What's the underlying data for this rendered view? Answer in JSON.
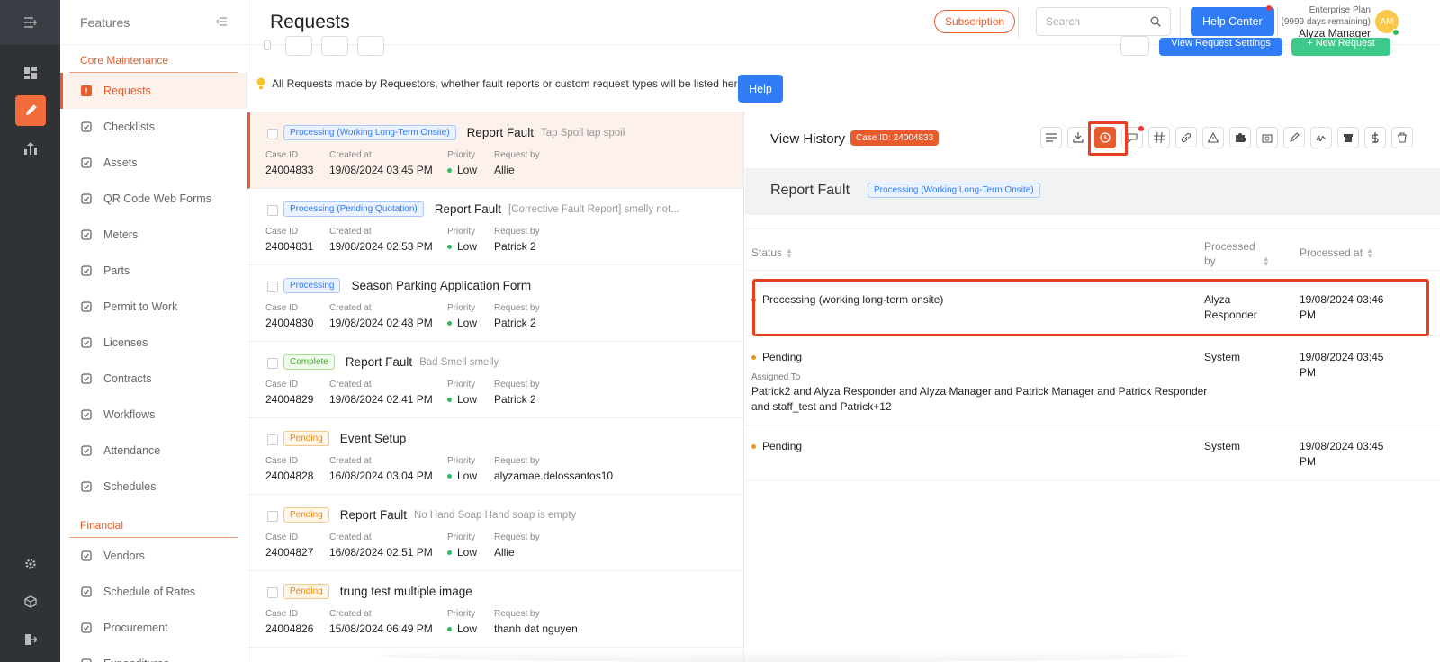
{
  "header": {
    "title": "Requests",
    "subscription_label": "Subscription",
    "search_placeholder": "Search",
    "help_center_label": "Help Center",
    "plan_name": "Enterprise Plan",
    "plan_remaining": "(9999 days remaining)",
    "user_name": "Alyza Manager",
    "avatar_initials": "AM"
  },
  "features": {
    "title": "Features",
    "sections": [
      {
        "label": "Core Maintenance",
        "items": [
          {
            "label": "Requests",
            "icon": "request-icon",
            "active": true
          },
          {
            "label": "Checklists",
            "icon": "checklist-icon"
          },
          {
            "label": "Assets",
            "icon": "asset-icon"
          },
          {
            "label": "QR Code Web Forms",
            "icon": "qr-code-icon"
          },
          {
            "label": "Meters",
            "icon": "meter-icon"
          },
          {
            "label": "Parts",
            "icon": "puzzle-icon"
          },
          {
            "label": "Permit to Work",
            "icon": "helmet-icon"
          },
          {
            "label": "Licenses",
            "icon": "shield-icon"
          },
          {
            "label": "Contracts",
            "icon": "contract-icon"
          },
          {
            "label": "Workflows",
            "icon": "workflow-icon"
          },
          {
            "label": "Attendance",
            "icon": "attendance-icon"
          },
          {
            "label": "Schedules",
            "icon": "calendar-icon"
          }
        ]
      },
      {
        "label": "Financial",
        "items": [
          {
            "label": "Vendors",
            "icon": "vendor-icon"
          },
          {
            "label": "Schedule of Rates",
            "icon": "dollar-icon"
          },
          {
            "label": "Procurement",
            "icon": "procurement-icon"
          },
          {
            "label": "Expenditures",
            "icon": "expenditure-icon"
          }
        ]
      }
    ]
  },
  "info": {
    "text": "All Requests made by Requestors, whether fault reports or custom request types will be listed here.",
    "help_label": "Help",
    "view_settings_label": "View Request Settings",
    "new_request_label": "+ New Request"
  },
  "labels": {
    "case_id": "Case ID",
    "created_at": "Created at",
    "priority": "Priority",
    "request_by": "Request by"
  },
  "requests": [
    {
      "badge": "Processing (Working Long-Term Onsite)",
      "badge_color": "blue",
      "title": "Report Fault",
      "sub": "Tap Spoil   tap spoil",
      "case_id": "24004833",
      "created": "19/08/2024 03:45 PM",
      "priority": "Low",
      "by": "Allie",
      "active": true
    },
    {
      "badge": "Processing (Pending Quotation)",
      "badge_color": "blue",
      "title": "Report Fault",
      "sub": "[Corrective Fault Report] smelly not...",
      "case_id": "24004831",
      "created": "19/08/2024 02:53 PM",
      "priority": "Low",
      "by": "Patrick 2"
    },
    {
      "badge": "Processing",
      "badge_color": "blue",
      "title": "Season Parking Application Form",
      "sub": "",
      "case_id": "24004830",
      "created": "19/08/2024 02:48 PM",
      "priority": "Low",
      "by": "Patrick 2"
    },
    {
      "badge": "Complete",
      "badge_color": "green",
      "title": "Report Fault",
      "sub": "Bad Smell   smelly",
      "case_id": "24004829",
      "created": "19/08/2024 02:41 PM",
      "priority": "Low",
      "by": "Patrick 2"
    },
    {
      "badge": "Pending",
      "badge_color": "orange",
      "title": "Event Setup",
      "sub": "",
      "case_id": "24004828",
      "created": "16/08/2024 03:04 PM",
      "priority": "Low",
      "by": "alyzamae.delossantos10"
    },
    {
      "badge": "Pending",
      "badge_color": "orange",
      "title": "Report Fault",
      "sub": "No Hand Soap   Hand soap is empty",
      "case_id": "24004827",
      "created": "16/08/2024 02:51 PM",
      "priority": "Low",
      "by": "Allie"
    },
    {
      "badge": "Pending",
      "badge_color": "orange",
      "title": "trung test multiple image",
      "sub": "",
      "case_id": "24004826",
      "created": "15/08/2024 06:49 PM",
      "priority": "Low",
      "by": "thanh dat nguyen"
    }
  ],
  "detail": {
    "view_history": "View History",
    "case_badge": "Case ID: 24004833",
    "title": "Report Fault",
    "status_badge": "Processing (Working Long-Term Onsite)",
    "columns": {
      "status": "Status",
      "processed_by_1": "Processed",
      "processed_by_2": "by",
      "processed_at": "Processed at"
    },
    "history": [
      {
        "status": "Processing (working long-term onsite)",
        "dot": "#2f7cf6",
        "by_1": "Alyza",
        "by_2": "Responder",
        "at_1": "19/08/2024 03:46",
        "at_2": "PM",
        "assigned_label": "",
        "assigned_1": "",
        "assigned_2": ""
      },
      {
        "status": "Pending",
        "dot": "#f0921f",
        "by_1": "System",
        "by_2": "",
        "at_1": "19/08/2024 03:45",
        "at_2": "PM",
        "assigned_label": "Assigned To",
        "assigned_1": "Patrick2 and Alyza Responder and Alyza Manager and Patrick Manager and Patrick Responder",
        "assigned_2": "and staff_test and Patrick+12"
      },
      {
        "status": "Pending",
        "dot": "#f0921f",
        "by_1": "System",
        "by_2": "",
        "at_1": "19/08/2024 03:45",
        "at_2": "PM",
        "assigned_label": "",
        "assigned_1": "",
        "assigned_2": ""
      }
    ]
  },
  "colors": {
    "accent": "#e85c2b",
    "primary": "#2f7cf6",
    "highlight": "#e8401f"
  }
}
